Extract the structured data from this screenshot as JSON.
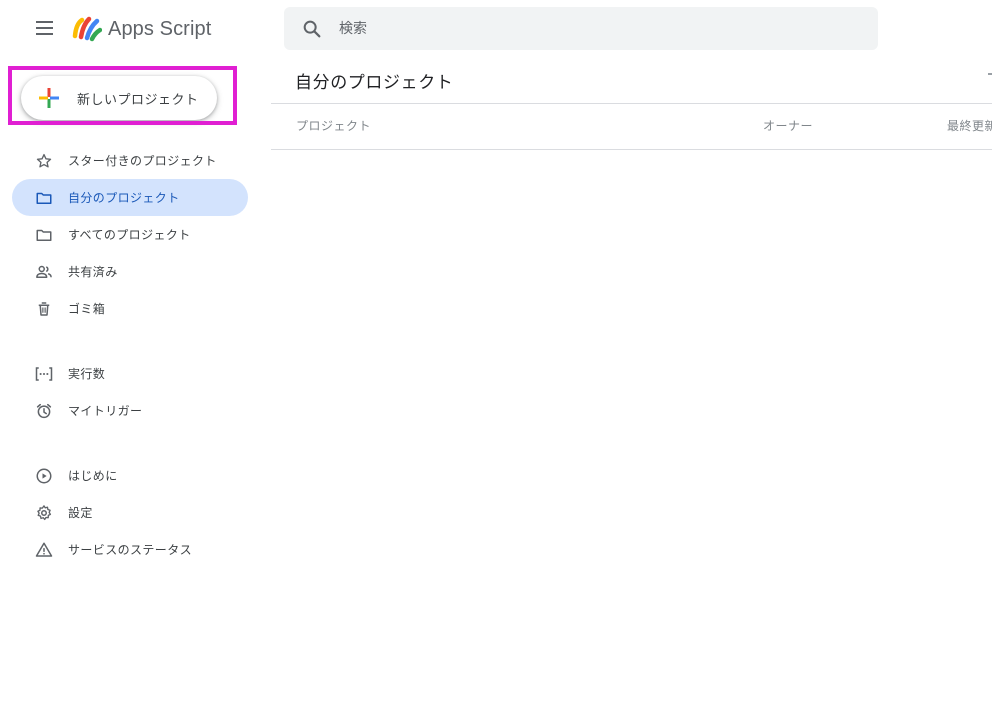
{
  "app": {
    "title": "Apps Script"
  },
  "search": {
    "placeholder": "検索"
  },
  "new_project": {
    "label": "新しいプロジェクト"
  },
  "sidebar": {
    "items": [
      {
        "label": "スター付きのプロジェクト",
        "icon": "star-icon"
      },
      {
        "label": "自分のプロジェクト",
        "icon": "folder-icon",
        "active": true
      },
      {
        "label": "すべてのプロジェクト",
        "icon": "folder-icon"
      },
      {
        "label": "共有済み",
        "icon": "people-icon"
      },
      {
        "label": "ゴミ箱",
        "icon": "trash-icon"
      },
      {
        "label": "実行数",
        "icon": "executions-icon"
      },
      {
        "label": "マイトリガー",
        "icon": "alarm-icon"
      },
      {
        "label": "はじめに",
        "icon": "play-circle-icon"
      },
      {
        "label": "設定",
        "icon": "gear-icon"
      },
      {
        "label": "サービスのステータス",
        "icon": "warning-icon"
      }
    ]
  },
  "main": {
    "title": "自分のプロジェクト",
    "columns": [
      "プロジェクト",
      "オーナー",
      "最終更新"
    ]
  },
  "colors": {
    "active_bg": "#d3e3fd",
    "active_text": "#1a58b8",
    "highlight": "#e01fd2",
    "search_bg": "#f1f3f4"
  }
}
